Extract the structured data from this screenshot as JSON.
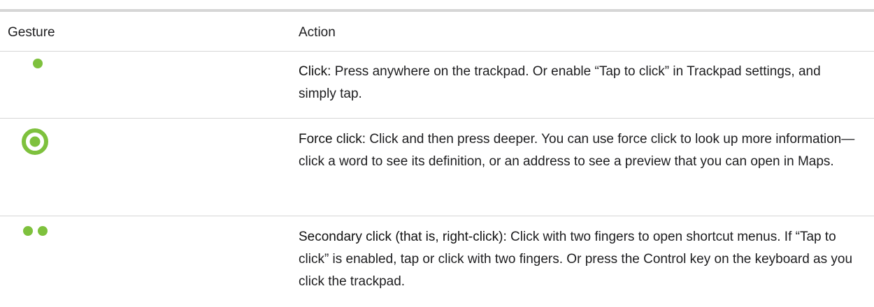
{
  "colors": {
    "accent_green": "#7ec13d",
    "divider": "#d6d6d6",
    "text": "#1d1d1f"
  },
  "table": {
    "headers": {
      "gesture": "Gesture",
      "action": "Action"
    },
    "rows": [
      {
        "gesture_icon": "one-finger-dot-icon",
        "title": "Click:",
        "description": " Press anywhere on the trackpad. Or enable “Tap to click” in Trackpad settings, and simply tap."
      },
      {
        "gesture_icon": "force-click-ring-icon",
        "title": "Force click:",
        "description": " Click and then press deeper. You can use force click to look up more information—click a word to see its definition, or an address to see a preview that you can open in Maps."
      },
      {
        "gesture_icon": "two-finger-dots-icon",
        "title": "Secondary click (that is, right-click):",
        "description": " Click with two fingers to open shortcut menus. If “Tap to click” is enabled, tap or click with two fingers. Or press the Control key on the keyboard as you click the trackpad."
      }
    ]
  }
}
